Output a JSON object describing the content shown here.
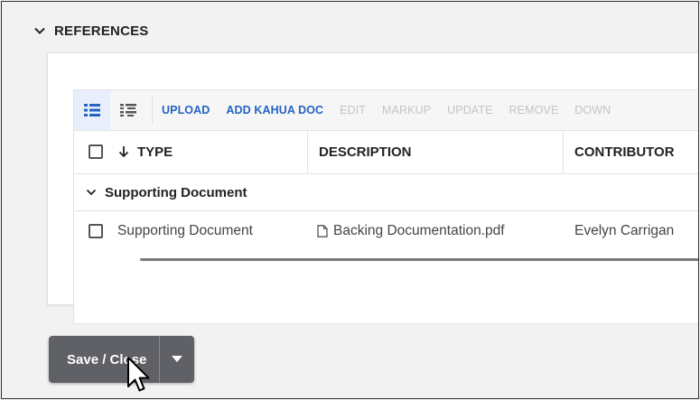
{
  "section": {
    "title": "REFERENCES",
    "icon": "chevron-down-icon"
  },
  "toolbar": {
    "view_buttons": [
      "list-view-icon",
      "detail-view-icon"
    ],
    "actions": [
      {
        "label": "UPLOAD",
        "enabled": true
      },
      {
        "label": "ADD KAHUA DOC",
        "enabled": true
      },
      {
        "label": "EDIT",
        "enabled": false
      },
      {
        "label": "MARKUP",
        "enabled": false
      },
      {
        "label": "UPDATE",
        "enabled": false
      },
      {
        "label": "REMOVE",
        "enabled": false
      },
      {
        "label": "DOWN",
        "enabled": false
      }
    ]
  },
  "table": {
    "columns": [
      "TYPE",
      "DESCRIPTION",
      "CONTRIBUTOR"
    ],
    "sort": {
      "column": "TYPE",
      "direction": "descending"
    },
    "group": {
      "label": "Supporting Document"
    },
    "rows": [
      {
        "type": "Supporting Document",
        "description": "Backing Documentation.pdf",
        "contributor": "Evelyn Carrigan"
      }
    ]
  },
  "footer": {
    "save_label": "Save / Close"
  },
  "colors": {
    "accent": "#2463c4",
    "button": "#5f6166",
    "disabled": "#c4c4c4"
  }
}
